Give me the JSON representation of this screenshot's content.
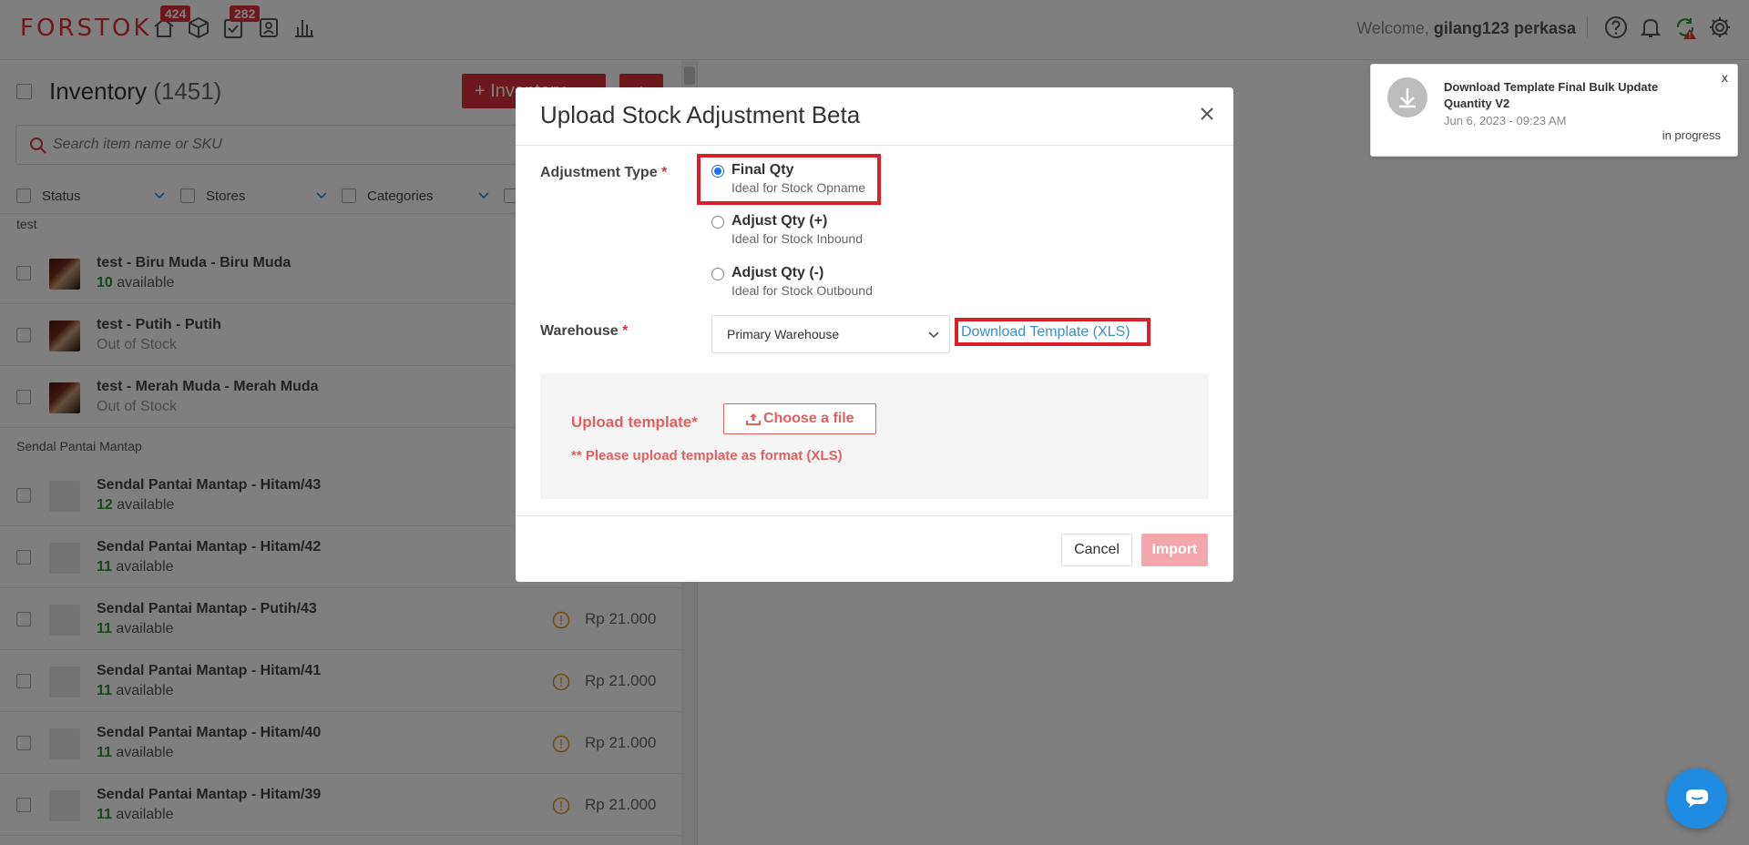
{
  "app": {
    "logo": "FORSTOK",
    "nav_badges": [
      "424",
      "282"
    ],
    "welcome_prefix": "Welcome,",
    "username": "gilang123 perkasa"
  },
  "inventory": {
    "title": "Inventory",
    "count": "(1451)",
    "add_button": "+ Inventory",
    "search_placeholder": "Search item name or SKU",
    "filters": [
      "Status",
      "Stores",
      "Categories"
    ],
    "groups": [
      {
        "label": "test",
        "items": [
          {
            "name": "test - Biru Muda - Biru Muda",
            "qty": "10",
            "qty_label": "available",
            "price": ""
          },
          {
            "name": "test - Putih - Putih",
            "qty": "",
            "qty_label": "Out of Stock",
            "price": ""
          },
          {
            "name": "test - Merah Muda - Merah Muda",
            "qty": "",
            "qty_label": "Out of Stock",
            "price": ""
          }
        ]
      },
      {
        "label": "Sendal Pantai Mantap",
        "items": [
          {
            "name": "Sendal Pantai Mantap - Hitam/43",
            "qty": "12",
            "qty_label": "available",
            "price": ""
          },
          {
            "name": "Sendal Pantai Mantap - Hitam/42",
            "qty": "11",
            "qty_label": "available",
            "price": ""
          },
          {
            "name": "Sendal Pantai Mantap - Putih/43",
            "qty": "11",
            "qty_label": "available",
            "price": "Rp 21.000"
          },
          {
            "name": "Sendal Pantai Mantap - Hitam/41",
            "qty": "11",
            "qty_label": "available",
            "price": "Rp 21.000"
          },
          {
            "name": "Sendal Pantai Mantap - Hitam/40",
            "qty": "11",
            "qty_label": "available",
            "price": "Rp 21.000"
          },
          {
            "name": "Sendal Pantai Mantap - Hitam/39",
            "qty": "11",
            "qty_label": "available",
            "price": "Rp 21.000"
          }
        ]
      }
    ]
  },
  "notification": {
    "title": "Download Template Final Bulk Update Quantity V2",
    "date": "Jun 6, 2023 - 09:23 AM",
    "status": "in progress",
    "close": "x"
  },
  "modal": {
    "title": "Upload Stock Adjustment Beta",
    "adjustment_type_label": "Adjustment Type",
    "required_mark": "*",
    "options": [
      {
        "title": "Final Qty",
        "subtitle": "Ideal for Stock Opname",
        "selected": true
      },
      {
        "title": "Adjust Qty (+)",
        "subtitle": "Ideal for Stock Inbound",
        "selected": false
      },
      {
        "title": "Adjust Qty (-)",
        "subtitle": "Ideal for Stock Outbound",
        "selected": false
      }
    ],
    "warehouse_label": "Warehouse",
    "warehouse_value": "Primary Warehouse",
    "download_link": "Download Template (XLS)",
    "upload_label": "Upload template*",
    "choose_file": "Choose a file",
    "upload_note": "** Please upload template as format (XLS)",
    "cancel": "Cancel",
    "import": "Import"
  },
  "colors": {
    "brand": "#d9313a",
    "highlight": "#d9202a",
    "link": "#3a8fc6",
    "available": "#2f8f2f",
    "chat": "#1e8be0"
  }
}
